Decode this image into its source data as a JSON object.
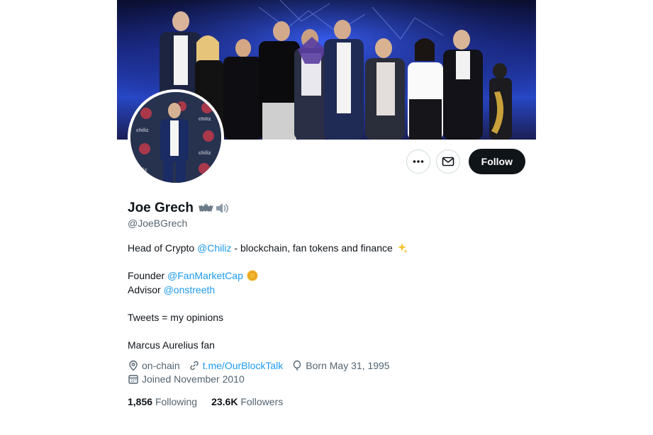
{
  "profile": {
    "display_name": "Joe Grech",
    "handle": "@JoeBGrech",
    "name_emojis": [
      "bat-icon",
      "speaker-icon"
    ]
  },
  "actions": {
    "more_icon": "more-icon",
    "message_icon": "envelope-icon",
    "follow_label": "Follow"
  },
  "bio": {
    "line1_prefix": "Head of Crypto ",
    "line1_mention": "@Chiliz",
    "line1_suffix": " - blockchain, fan tokens and finance",
    "line2_prefix": "Founder ",
    "line2_mention": "@FanMarketCap",
    "line3_prefix": "Advisor ",
    "line3_mention": "@onstreeth",
    "line4": "Tweets = my opinions",
    "line5": "Marcus Aurelius fan"
  },
  "meta": {
    "location": "on-chain",
    "website": "t.me/OurBlockTalk",
    "birthday": "Born May 31, 1995",
    "joined": "Joined November 2010"
  },
  "stats": {
    "following_count": "1,856",
    "following_label": "Following",
    "followers_count": "23.6K",
    "followers_label": "Followers"
  },
  "colors": {
    "link": "#1d9bf0",
    "secondary_text": "#536471",
    "button_dark": "#0f1419"
  }
}
